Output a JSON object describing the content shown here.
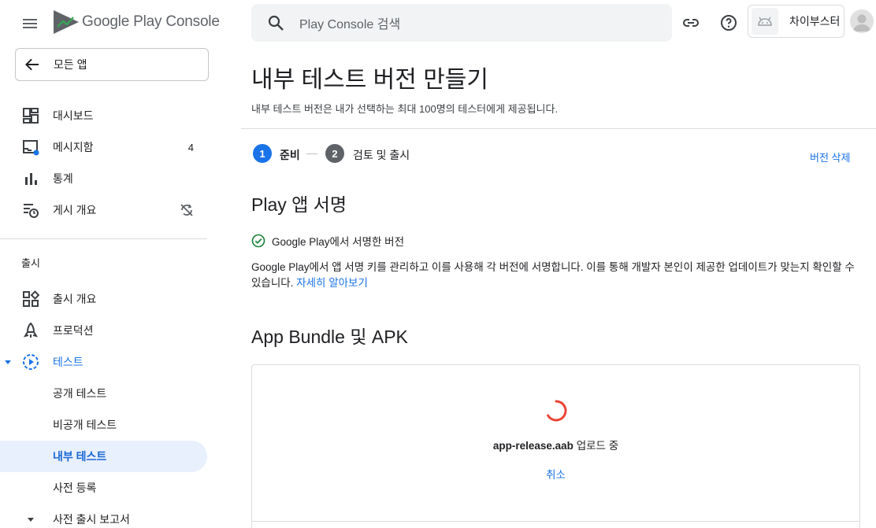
{
  "app": {
    "brand": "Google Play Console"
  },
  "sidebar": {
    "back_label": "모든 앱",
    "top_items": [
      {
        "label": "대시보드",
        "icon": "dashboard-icon"
      },
      {
        "label": "메시지함",
        "icon": "inbox-icon",
        "badge": "4"
      },
      {
        "label": "통계",
        "icon": "bar-chart-icon"
      },
      {
        "label": "게시 개요",
        "icon": "publishing-overview-icon"
      }
    ],
    "section_label": "출시",
    "release_items": [
      {
        "label": "출시 개요",
        "icon": "release-overview-icon"
      },
      {
        "label": "프로덕션",
        "icon": "production-icon"
      },
      {
        "label": "테스트",
        "icon": "testing-icon"
      }
    ],
    "testing_sub": [
      {
        "label": "공개 테스트"
      },
      {
        "label": "비공개 테스트"
      },
      {
        "label": "내부 테스트"
      },
      {
        "label": "사전 등록"
      }
    ],
    "prelaunch_label": "사전 출시 보고서"
  },
  "topbar": {
    "search_placeholder": "Play Console 검색",
    "account_name": "차이부스터"
  },
  "main": {
    "title": "내부 테스트 버전 만들기",
    "subtitle": "내부 테스트 버전은 내가 선택하는 최대 100명의 테스터에게 제공됩니다.",
    "steps": [
      {
        "num": "1",
        "label": "준비"
      },
      {
        "num": "2",
        "label": "검토 및 출시"
      }
    ],
    "delete_label": "버전 삭제",
    "signing": {
      "heading": "Play 앱 서명",
      "status": "Google Play에서 서명한 버전",
      "description": "Google Play에서 앱 서명 키를 관리하고 이를 사용해 각 버전에 서명합니다. 이를 통해 개발자 본인이 제공한 업데이트가 맞는지 확인할 수 있습니다.",
      "learn_more": "자세히 알아보기"
    },
    "bundles": {
      "heading": "App Bundle 및 APK",
      "file_name": "app-release.aab",
      "upload_status": " 업로드 중",
      "cancel_label": "취소"
    }
  },
  "colors": {
    "accent": "#1a73e8",
    "step_active": "#1a73e8",
    "step_inactive": "#5f6368",
    "success": "#188038",
    "spinner": "#ea4335"
  }
}
